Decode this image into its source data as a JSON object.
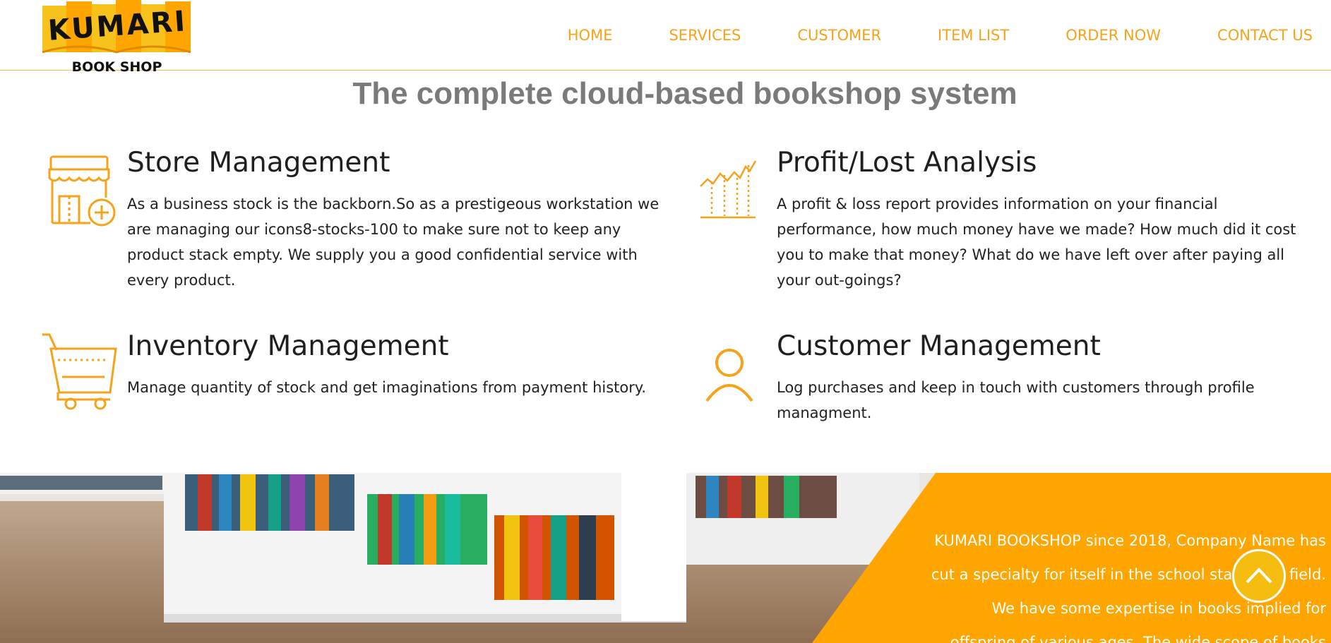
{
  "brand": {
    "logo_word": "KUMARI",
    "logo_sub": "BOOK SHOP",
    "accent": "#f5a31a",
    "banner_orange": "#ffa500"
  },
  "nav": {
    "items": [
      "HOME",
      "SERVICES",
      "CUSTOMER",
      "ITEM LIST",
      "ORDER NOW",
      "CONTACT US"
    ]
  },
  "headline": "The complete cloud-based bookshop system",
  "features": [
    {
      "icon": "store-icon",
      "title": "Store Management",
      "description": "As a business stock is the backborn.So as a prestigeous workstation we are managing our icons8-stocks-100 to make sure not to keep any product stack empty. We supply you a good confidential service with every product."
    },
    {
      "icon": "chart-icon",
      "title": "Profit/Lost Analysis",
      "description": "A profit & loss report provides information on your financial performance, how much money have we made? How much did it cost you to make that money? What do we have left over after paying all your out-goings?"
    },
    {
      "icon": "cart-icon",
      "title": "Inventory Management",
      "description": "Manage quantity of stock and get imaginations from payment history."
    },
    {
      "icon": "user-icon",
      "title": "Customer Management",
      "description": "Log purchases and keep in touch with customers through profile managment."
    }
  ],
  "banner": {
    "text": "KUMARI BOOKSHOP since 2018, Company Name has cut a specialty for itself in the school stationary field. We have some expertise in books implied for offspring of various ages. The wide scope of books"
  },
  "scroll_top": {
    "icon": "chevron-up-icon"
  }
}
